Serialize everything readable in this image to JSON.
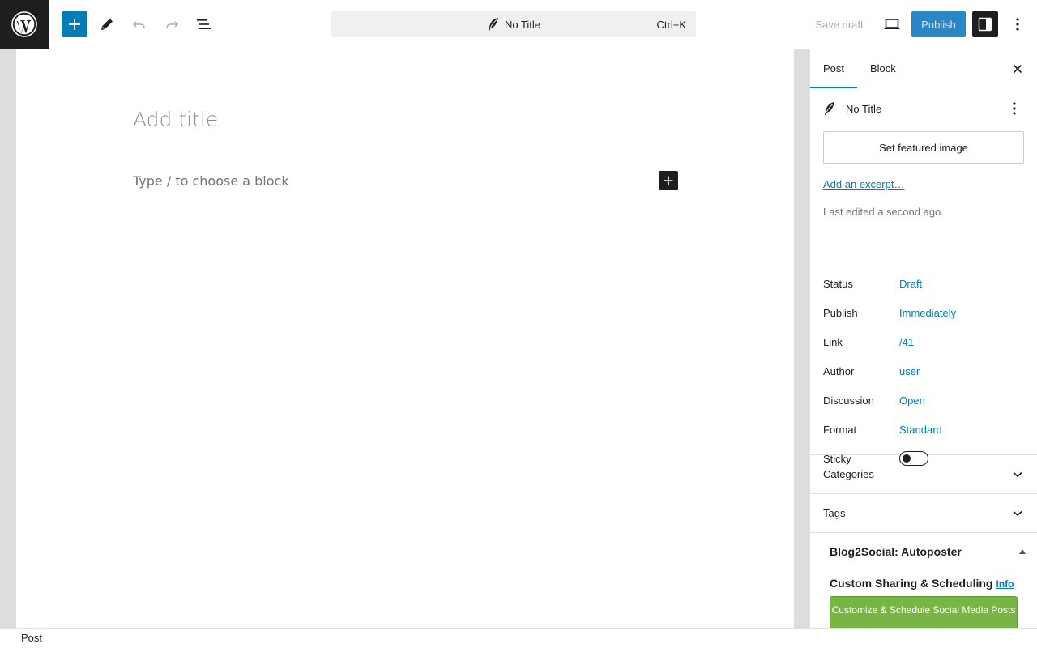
{
  "toolbar": {
    "add_block_icon": "plus-icon",
    "tools_icon": "pencil-icon",
    "undo_icon": "undo-icon",
    "redo_icon": "redo-icon",
    "list_view_icon": "list-view-icon",
    "command_bar": {
      "title": "No Title",
      "shortcut": "Ctrl+K",
      "icon": "quill-icon"
    },
    "save_draft_label": "Save draft",
    "preview_icon": "desktop-icon",
    "publish_label": "Publish",
    "settings_icon": "sidebar-toggle-icon",
    "options_icon": "vertical-ellipsis-icon"
  },
  "editor": {
    "title_placeholder": "Add title",
    "block_placeholder": "Type / to choose a block"
  },
  "sidebar": {
    "tabs": [
      {
        "label": "Post",
        "active": true
      },
      {
        "label": "Block",
        "active": false
      }
    ],
    "document": {
      "title": "No Title",
      "featured_image_label": "Set featured image",
      "excerpt_link": "Add an excerpt…",
      "last_edited": "Last edited a second ago."
    },
    "properties": [
      {
        "label": "Status",
        "value": "Draft"
      },
      {
        "label": "Publish",
        "value": "Immediately"
      },
      {
        "label": "Link",
        "value": "/41"
      },
      {
        "label": "Author",
        "value": "user"
      },
      {
        "label": "Discussion",
        "value": "Open"
      },
      {
        "label": "Format",
        "value": "Standard"
      }
    ],
    "sticky": {
      "label": "Sticky",
      "checked": false
    },
    "panels": [
      {
        "label": "Categories",
        "expanded": false
      },
      {
        "label": "Tags",
        "expanded": false
      }
    ],
    "blog2social": {
      "title": "Blog2Social: Autoposter",
      "subtitle": "Custom Sharing & Scheduling",
      "info_link": "Info",
      "button_label": "Customize & Schedule Social Media Posts"
    }
  },
  "footer": {
    "breadcrumb": "Post"
  },
  "colors": {
    "accent": "#007cba",
    "dark": "#1e1e1e",
    "b2s_green": "#79b545"
  }
}
